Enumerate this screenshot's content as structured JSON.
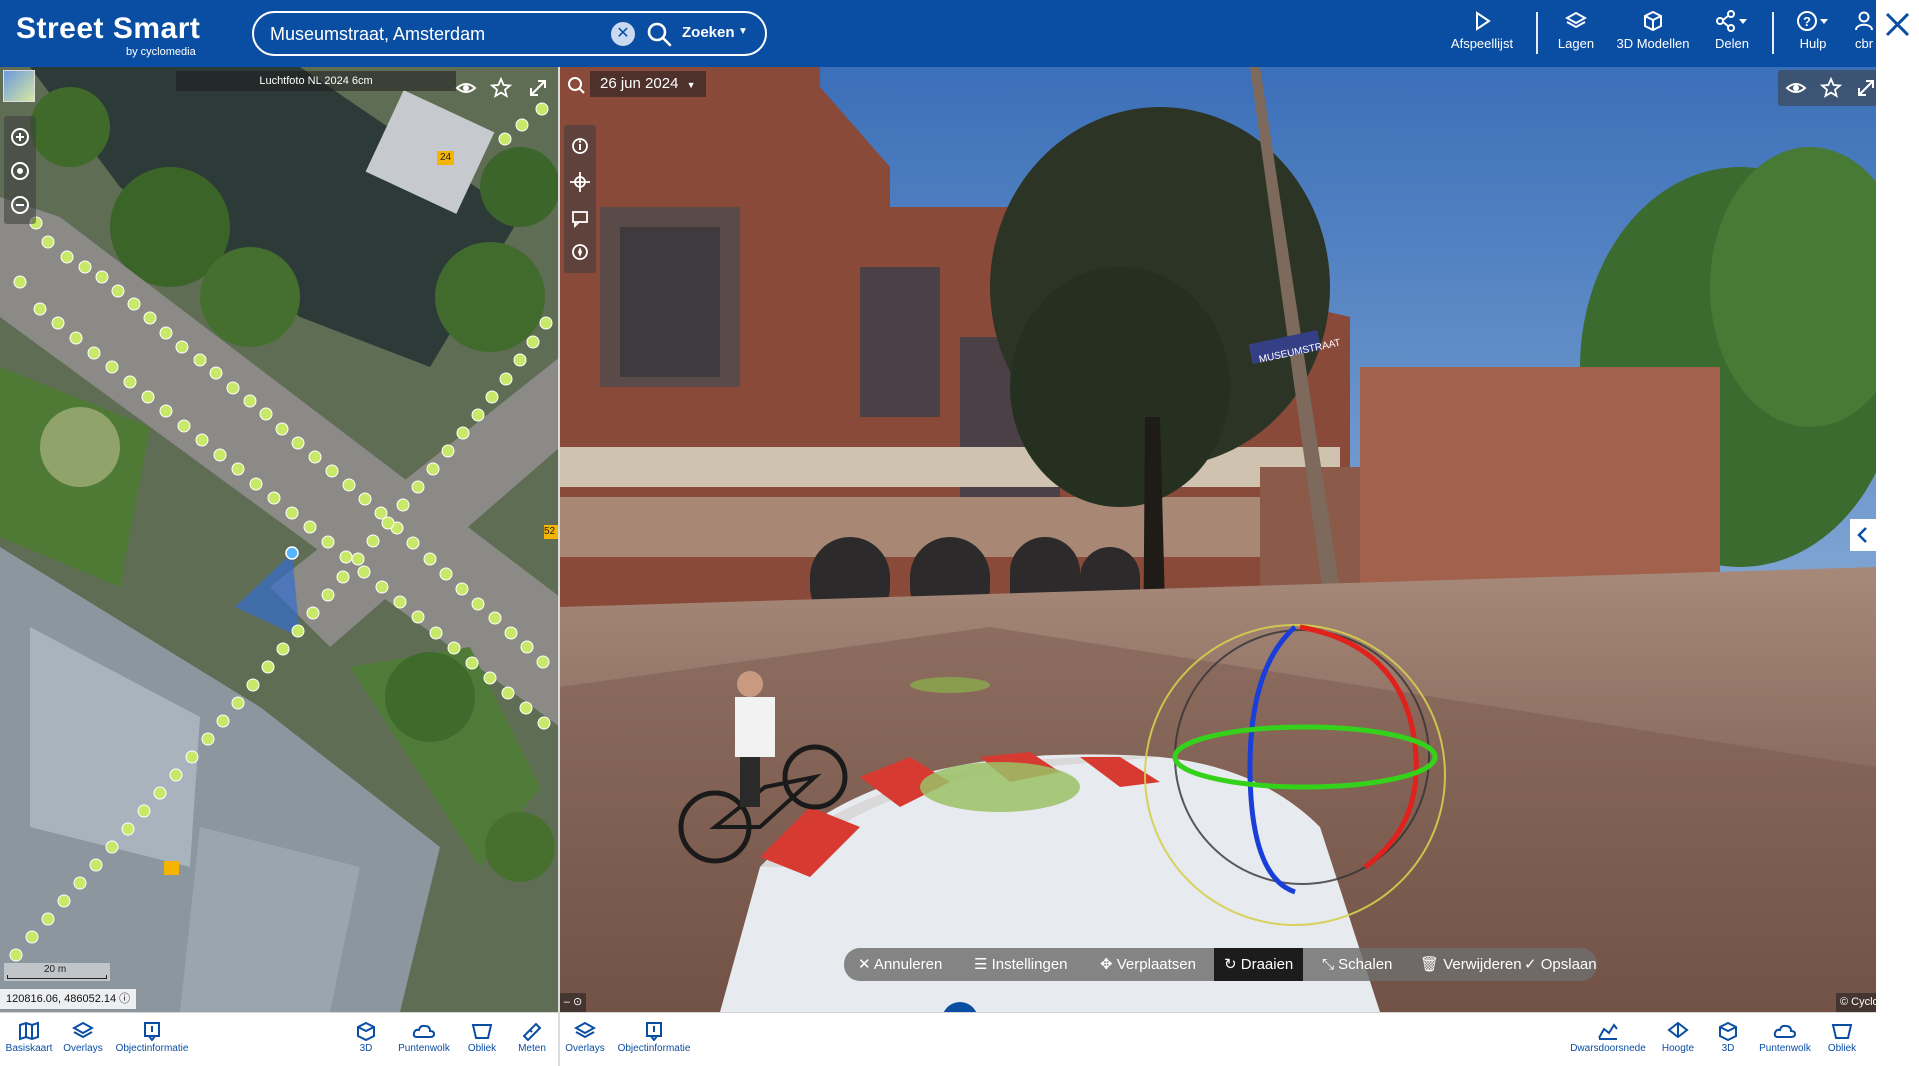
{
  "app": {
    "name": "Street Smart",
    "by": "by cyclomedia"
  },
  "search": {
    "value": "Museumstraat, Amsterdam",
    "button_label": "Zoeken"
  },
  "topnav": {
    "items": [
      {
        "label": "Afspeellijst",
        "icon": "play-icon"
      },
      {
        "label": "Lagen",
        "icon": "layers-icon"
      },
      {
        "label": "3D Modellen",
        "icon": "cube-icon"
      },
      {
        "label": "Delen",
        "icon": "share-icon"
      },
      {
        "label": "Hulp",
        "icon": "help-icon"
      },
      {
        "label": "cbr",
        "icon": "user-icon"
      }
    ]
  },
  "map": {
    "layer_label": "Luchtfoto NL 2024 6cm",
    "scale_label": "20 m",
    "coordinates": "120816.06, 486052.14",
    "markers": [
      "24",
      "52"
    ]
  },
  "pano": {
    "date": "26 jun 2024",
    "street_sign": "MUSEUMSTRAAT",
    "copyright": "© Cyclo"
  },
  "edit_toolbar": {
    "items": [
      {
        "label": "Annuleren",
        "icon": "close-icon"
      },
      {
        "label": "Instellingen",
        "icon": "sliders-icon"
      },
      {
        "label": "Verplaatsen",
        "icon": "move-icon"
      },
      {
        "label": "Draaien",
        "icon": "rotate-icon",
        "active": true
      },
      {
        "label": "Schalen",
        "icon": "scale-icon"
      },
      {
        "label": "Verwijderen",
        "icon": "trash-icon"
      },
      {
        "label": "Opslaan",
        "icon": "check-icon"
      }
    ]
  },
  "bottombar": {
    "left": [
      {
        "label": "Basiskaart",
        "icon": "map-icon"
      },
      {
        "label": "Overlays",
        "icon": "layers-icon"
      },
      {
        "label": "Objectinformatie",
        "icon": "info-icon"
      },
      {
        "label": "3D",
        "icon": "cube-icon"
      },
      {
        "label": "Puntenwolk",
        "icon": "cloud-icon"
      },
      {
        "label": "Obliek",
        "icon": "oblique-icon"
      },
      {
        "label": "Meten",
        "icon": "ruler-icon"
      }
    ],
    "middle": [
      {
        "label": "Overlays",
        "icon": "layers-icon"
      },
      {
        "label": "Objectinformatie",
        "icon": "info-icon"
      }
    ],
    "right": [
      {
        "label": "Dwarsdoorsnede",
        "icon": "cross-section-icon"
      },
      {
        "label": "Hoogte",
        "icon": "height-icon"
      },
      {
        "label": "3D",
        "icon": "cube-icon"
      },
      {
        "label": "Puntenwolk",
        "icon": "cloud-icon"
      },
      {
        "label": "Obliek",
        "icon": "oblique-icon"
      }
    ]
  },
  "colors": {
    "brand": "#0a4ea4",
    "toolbar_bg": "#ffffff",
    "edit_toolbar_bg": "#6e6e6e"
  }
}
